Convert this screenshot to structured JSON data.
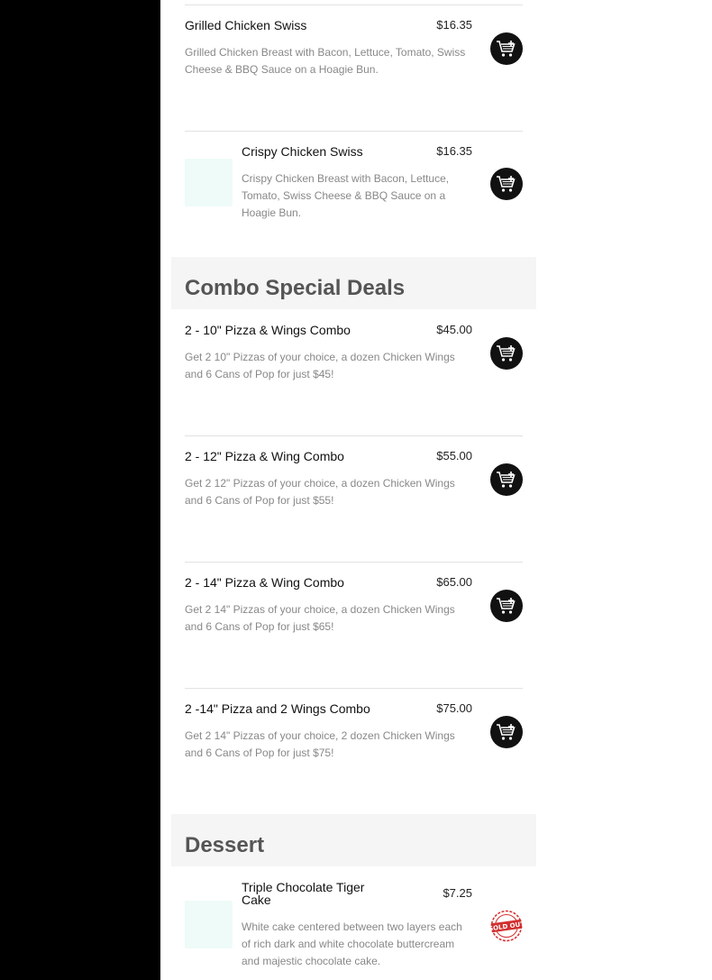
{
  "sections": {
    "combo_title": "Combo Special Deals",
    "dessert_title": "Dessert"
  },
  "items": [
    {
      "name": "Grilled Chicken Swiss",
      "price": "$16.35",
      "desc": "Grilled Chicken Breast with Bacon, Lettuce, Tomato, Swiss Cheese & BBQ Sauce on a Hoagie Bun."
    },
    {
      "name": "Crispy Chicken Swiss",
      "price": "$16.35",
      "desc": "Crispy Chicken Breast with Bacon, Lettuce, Tomato, Swiss Cheese & BBQ Sauce on a Hoagie Bun."
    },
    {
      "name": "2 - 10\" Pizza & Wings Combo",
      "price": "$45.00",
      "desc": "Get 2 10\" Pizzas of your choice, a dozen Chicken Wings and 6 Cans of Pop for just $45!"
    },
    {
      "name": "2 - 12\" Pizza & Wing Combo",
      "price": "$55.00",
      "desc": "Get 2 12\" Pizzas of your choice, a dozen Chicken Wings and 6 Cans of Pop for just $55!"
    },
    {
      "name": "2 - 14\" Pizza & Wing Combo",
      "price": "$65.00",
      "desc": "Get 2 14\" Pizzas of your choice, a dozen Chicken Wings and 6 Cans of Pop for just $65!"
    },
    {
      "name": "2 -14\" Pizza and 2 Wings Combo",
      "price": "$75.00",
      "desc": "Get 2 14\" Pizzas of your choice, 2 dozen Chicken Wings and 6 Cans of Pop for just $75!"
    },
    {
      "name": "Triple Chocolate Tiger Cake",
      "price": "$7.25",
      "desc": "White cake centered between two layers each of rich dark and white chocolate buttercream and majestic chocolate cake.",
      "badge": "SOLD OUT"
    }
  ],
  "icons": {
    "cart": "add-to-cart-icon",
    "soldout": "sold-out-stamp-icon"
  },
  "colors": {
    "sidebar": "#000000",
    "section_bg": "#f5f5f5",
    "cart_button": "#111111",
    "sold_out": "#d32f2f",
    "thumb_placeholder": "#eefbf8"
  }
}
